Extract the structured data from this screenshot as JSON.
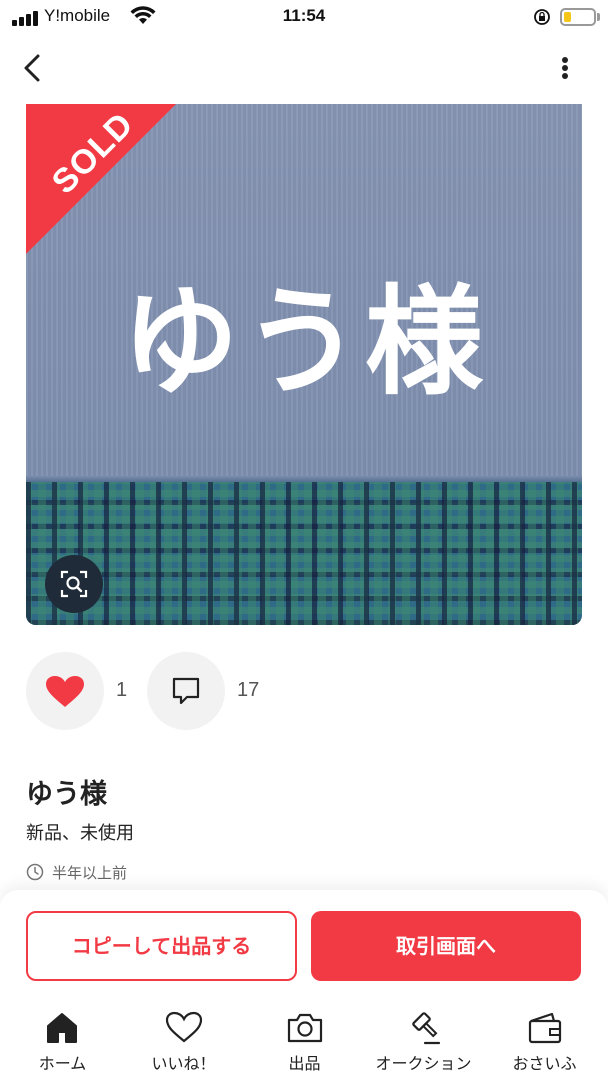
{
  "status_bar": {
    "carrier": "Y!mobile",
    "time": "11:54",
    "battery_level": 0.25
  },
  "product": {
    "image_text": "ゆう様",
    "sold_badge": "SOLD",
    "title": "ゆう様",
    "condition": "新品、未使用",
    "posted": "半年以上前"
  },
  "actions": {
    "likes": "1",
    "comments": "17"
  },
  "buttons": {
    "copy_listing": "コピーして出品する",
    "trade_screen": "取引画面へ"
  },
  "tabs": [
    {
      "label": "ホーム",
      "icon": "home-icon"
    },
    {
      "label": "いいね！",
      "icon": "heart-outline-icon"
    },
    {
      "label": "出品",
      "icon": "camera-icon"
    },
    {
      "label": "オークション",
      "icon": "gavel-icon"
    },
    {
      "label": "おさいふ",
      "icon": "wallet-icon"
    }
  ],
  "colors": {
    "accent": "#f23a45"
  }
}
